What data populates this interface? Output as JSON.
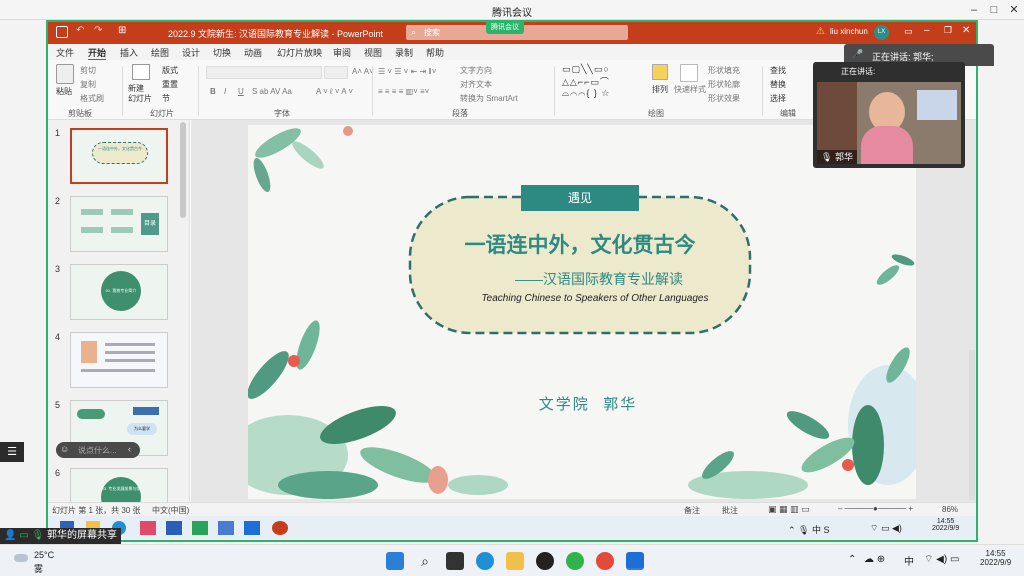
{
  "meeting": {
    "title": "腾讯会议",
    "speaking_header": "正在讲话: 郭华;",
    "speaking_label": "正在讲话:",
    "speaker_name": "郭华",
    "sharing_label": "郭华的屏幕共享",
    "chat_placeholder": "说点什么..."
  },
  "ppt": {
    "doc_title": "2022.9 文院新生: 汉语国际教育专业解读  -  PowerPoint",
    "search_placeholder": "搜索",
    "meeting_tag": "腾讯会议",
    "user": "liu xinchun",
    "user_initials": "LX",
    "menu": [
      "文件",
      "开始",
      "插入",
      "绘图",
      "设计",
      "切换",
      "动画",
      "幻灯片放映",
      "审阅",
      "视图",
      "录制",
      "帮助"
    ],
    "ribbon": {
      "paste": "粘贴",
      "cut": "剪切",
      "copy": "复制",
      "format_painter": "格式刷",
      "clipboard": "剪贴板",
      "new_slide": "新建\n幻灯片",
      "layout": "版式",
      "reset": "重置",
      "section": "节",
      "slides": "幻灯片",
      "font": "字体",
      "text_dir": "文字方向",
      "align_text": "对齐文本",
      "smartart": "转换为 SmartArt",
      "paragraph": "段落",
      "arrange": "排列",
      "quick_styles": "快速样式",
      "shape_fill": "形状填充",
      "shape_outline": "形状轮廓",
      "shape_effects": "形状效果",
      "drawing": "绘图",
      "find": "查找",
      "replace": "替换",
      "select": "选择",
      "editing": "编辑"
    },
    "slide": {
      "tag": "遇见",
      "title": "一语连中外，文化贯古今",
      "subtitle": "——汉语国际教育专业解读",
      "english": "Teaching Chinese to Speakers of Other Languages",
      "author": "文学院  郭华"
    },
    "thumbs": [
      {
        "num": "1",
        "label": "一语连中外，文化贯古今"
      },
      {
        "num": "2",
        "label": "目录"
      },
      {
        "num": "3",
        "label": "01. 我校专业简介"
      },
      {
        "num": "4",
        "label": ""
      },
      {
        "num": "5",
        "label": "为么要学"
      },
      {
        "num": "6",
        "label": "03. 专业发展前景与就业"
      }
    ],
    "status": {
      "slide_count": "幻灯片 第 1 张，共 30 张",
      "language": "中文(中国)",
      "notes": "备注",
      "comments": "批注",
      "zoom": "86%"
    },
    "inner_time": "14:55",
    "inner_date": "2022/9/9"
  },
  "taskbar": {
    "temp": "25°C",
    "weather": "雾",
    "ime": "中",
    "time": "14:55",
    "date": "2022/9/9"
  },
  "colors": {
    "ppt_red": "#c43e1c",
    "meeting_green": "#2fb36a",
    "slide_teal": "#2d8a83",
    "dashed_border": "#2f6f6a",
    "ellipse_fill": "#ede9cc"
  }
}
